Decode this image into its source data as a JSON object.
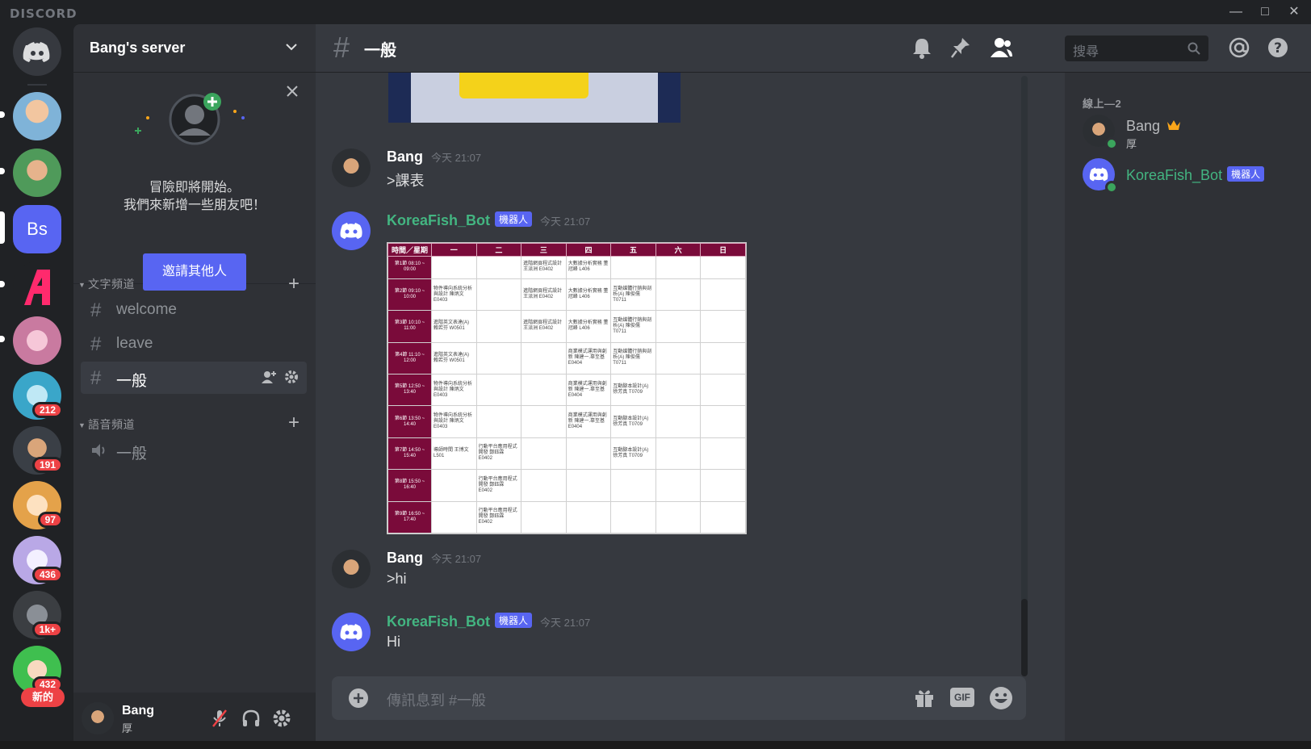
{
  "window": {
    "brand": "DISCORD"
  },
  "colors": {
    "blurple": "#5865f2",
    "online": "#3ba55d",
    "badge": "#ed4245",
    "bot_name": "#43b581",
    "schedule_header": "#7a0b3a"
  },
  "guilds": [
    {
      "name": "avatar-1",
      "badge": ""
    },
    {
      "name": "avatar-2",
      "badge": ""
    },
    {
      "name": "Bs",
      "badge": ""
    },
    {
      "name": "red-a-logo",
      "badge": ""
    },
    {
      "name": "avatar-5",
      "badge": ""
    },
    {
      "name": "avatar-6",
      "badge": "212"
    },
    {
      "name": "avatar-7",
      "badge": "191"
    },
    {
      "name": "avatar-8",
      "badge": "97"
    },
    {
      "name": "avatar-9",
      "badge": "436"
    },
    {
      "name": "avatar-10",
      "badge": "1k+"
    },
    {
      "name": "avatar-11",
      "badge": "432"
    }
  ],
  "new_label": "新的",
  "server": {
    "name": "Bang's server",
    "invite": {
      "line1": "冒險即將開始。",
      "line2": "我們來新增一些朋友吧！",
      "button": "邀請其他人"
    },
    "text_category": "文字頻道",
    "voice_category": "語音頻道",
    "text_channels": [
      "welcome",
      "leave",
      "一般"
    ],
    "voice_channels": [
      "一般"
    ]
  },
  "user": {
    "name": "Bang",
    "status": "厚"
  },
  "channel": {
    "hash": "#",
    "name": "一般"
  },
  "search": {
    "placeholder": "搜尋"
  },
  "messages": [
    {
      "author": "Bang",
      "time": "今天 21:07",
      "text": ">課表",
      "bot": false
    },
    {
      "author": "KoreaFish_Bot",
      "time": "今天 21:07",
      "text": "",
      "bot": true,
      "bot_tag": "機器人"
    },
    {
      "author": "Bang",
      "time": "今天 21:07",
      "text": ">hi",
      "bot": false
    },
    {
      "author": "KoreaFish_Bot",
      "time": "今天 21:07",
      "text": "Hi",
      "bot": true,
      "bot_tag": "機器人"
    }
  ],
  "schedule": {
    "headers": [
      "時間／星期",
      "一",
      "二",
      "三",
      "四",
      "五",
      "六",
      "日"
    ],
    "rows": [
      [
        "第1節 08:10 ~ 09:00",
        "",
        "",
        "進階網頁程式設計 王派洲 E0402",
        "大數據分析實務 董冠峰 L406",
        "",
        "",
        ""
      ],
      [
        "第2節 09:10 ~ 10:00",
        "物件導向系統分析與設計 陳炳文 E0403",
        "",
        "進階網頁程式設計 王派洲 E0402",
        "大數據分析實務 董冠峰 L406",
        "互動媒體行銷與剖析(A) 陳俊儒 T0711",
        "",
        ""
      ],
      [
        "第3節 10:10 ~ 11:00",
        "進階英文表達(A) 賴若芬 W0501",
        "",
        "進階網頁程式設計 王派洲 E0402",
        "大數據分析實務 董冠峰 L406",
        "互動媒體行銷與剖析(A) 陳俊儒 T0711",
        "",
        ""
      ],
      [
        "第4節 11:10 ~ 12:00",
        "進階英文表達(A) 賴若芬 W0501",
        "",
        "",
        "商業模式運用與創新 陳建一.辜至基 E0404",
        "互動媒體行銷與剖析(A) 陳俊儒 T0711",
        "",
        ""
      ],
      [
        "第5節 12:50 ~ 13:40",
        "物件導向系統分析與設計 陳炳文 E0403",
        "",
        "",
        "商業模式運用與創新 陳建一.辜至基 E0404",
        "互動腳本設計(A) 徐芳真 T0709",
        "",
        ""
      ],
      [
        "第6節 13:50 ~ 14:40",
        "物件導向系統分析與設計 陳炳文 E0403",
        "",
        "",
        "商業模式運用與創新 陳建一.辜至基 E0404",
        "互動腳本設計(A) 徐芳真 T0709",
        "",
        ""
      ],
      [
        "第7節 14:50 ~ 15:40",
        "導師時間 王博文 L501",
        "行動平台應用程式開發 鄭鈺霖 E0402",
        "",
        "",
        "互動腳本設計(A) 徐芳真 T0709",
        "",
        ""
      ],
      [
        "第8節 15:50 ~ 16:40",
        "",
        "行動平台應用程式開發 鄭鈺霖 E0402",
        "",
        "",
        "",
        "",
        ""
      ],
      [
        "第9節 16:50 ~ 17:40",
        "",
        "行動平台應用程式開發 鄭鈺霖 E0402",
        "",
        "",
        "",
        "",
        ""
      ]
    ]
  },
  "composer": {
    "placeholder": "傳訊息到 #一般",
    "gif": "GIF"
  },
  "members": {
    "header": "線上—2",
    "list": [
      {
        "name": "Bang",
        "status": "厚",
        "owner": true
      },
      {
        "name": "KoreaFish_Bot",
        "bot_tag": "機器人"
      }
    ]
  }
}
